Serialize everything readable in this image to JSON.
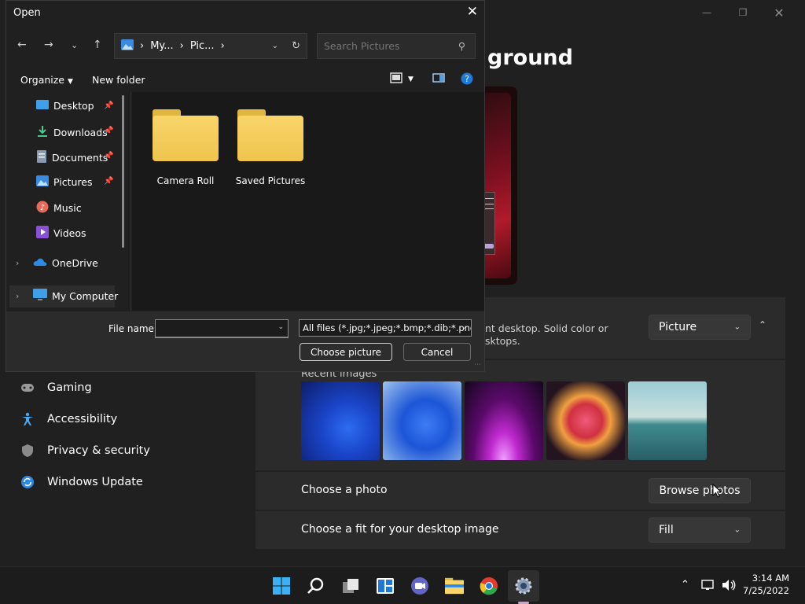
{
  "settings": {
    "title_fragment": "ground",
    "background_card": {
      "desc_line1": "nt desktop. Solid color or",
      "desc_line2": "sktops.",
      "type_value": "Picture"
    },
    "recent": {
      "label": "Recent images",
      "thumb_names": [
        "blue bloom wallpaper",
        "blue bloom light wallpaper",
        "purple glow wallpaper",
        "abstract flower wallpaper",
        "lake sunrise wallpaper"
      ]
    },
    "choose_photo": {
      "label": "Choose a photo",
      "button": "Browse photos"
    },
    "fit": {
      "label": "Choose a fit for your desktop image",
      "value": "Fill"
    },
    "nav": [
      {
        "label": "Gaming",
        "icon": "gamepad-icon"
      },
      {
        "label": "Accessibility",
        "icon": "accessibility-icon"
      },
      {
        "label": "Privacy & security",
        "icon": "shield-icon"
      },
      {
        "label": "Windows Update",
        "icon": "update-icon"
      }
    ]
  },
  "dialog": {
    "title": "Open",
    "address": {
      "seg1": "My...",
      "seg2": "Pic..."
    },
    "search_placeholder": "Search Pictures",
    "organize": "Organize",
    "new_folder": "New folder",
    "tree": [
      {
        "label": "Desktop",
        "pinned": true
      },
      {
        "label": "Downloads",
        "pinned": true
      },
      {
        "label": "Documents",
        "pinned": true
      },
      {
        "label": "Pictures",
        "pinned": true
      },
      {
        "label": "Music",
        "pinned": false
      },
      {
        "label": "Videos",
        "pinned": false
      },
      {
        "label": "OneDrive",
        "pinned": false
      },
      {
        "label": "My Computer",
        "pinned": false
      }
    ],
    "folders": [
      "Camera Roll",
      "Saved Pictures"
    ],
    "file_name_label": "File name:",
    "file_name_value": "",
    "file_type": "All files (*.jpg;*.jpeg;*.bmp;*.dib;*.png",
    "choose_button": "Choose picture",
    "cancel_button": "Cancel"
  },
  "taskbar": {
    "time": "3:14 AM",
    "date": "7/25/2022"
  },
  "colors": {
    "accent": "#0078d4",
    "folder": "#f9d56a",
    "surface": "#2b2b2b"
  }
}
